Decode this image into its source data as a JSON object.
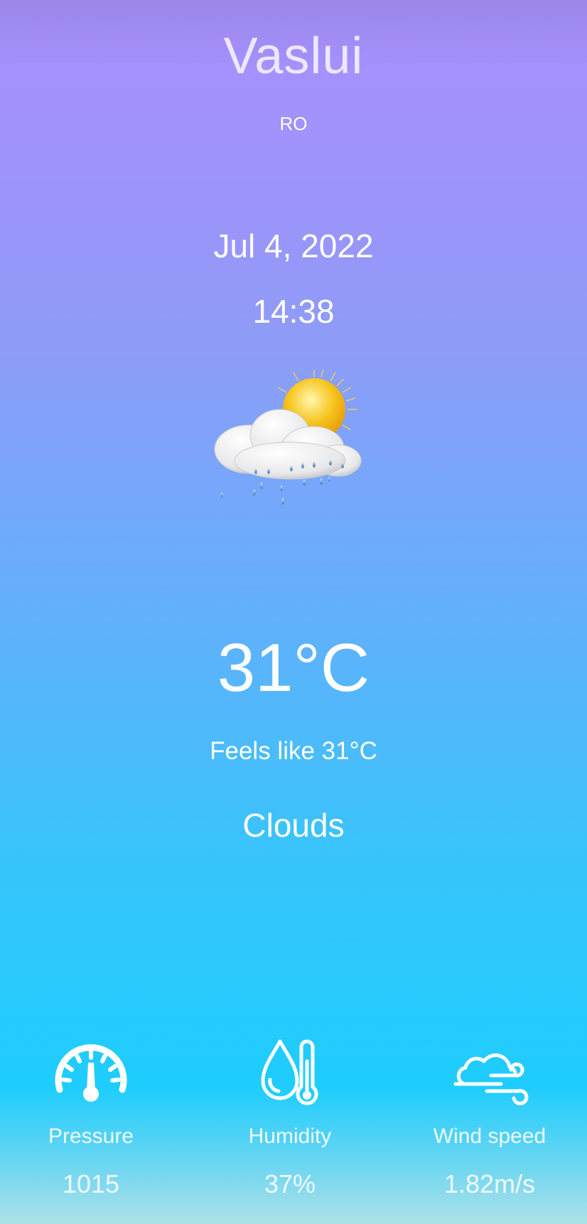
{
  "location": {
    "city": "Vaslui",
    "country": "RO"
  },
  "datetime": {
    "date": "Jul 4, 2022",
    "time": "14:38"
  },
  "current": {
    "icon": "sun-behind-cloud-with-rain-icon",
    "temperature": "31°C",
    "feels_like": "Feels like 31°C",
    "condition": "Clouds"
  },
  "stats": [
    {
      "icon": "pressure-gauge-icon",
      "label": "Pressure",
      "value": "1015"
    },
    {
      "icon": "humidity-drop-thermometer-icon",
      "label": "Humidity",
      "value": "37%"
    },
    {
      "icon": "wind-cloud-icon",
      "label": "Wind speed",
      "value": "1.82m/s"
    }
  ],
  "colors": {
    "gradient_top": "#a691fd",
    "gradient_middle": "#6faafb",
    "gradient_bottom": "#1ecdfd",
    "text": "#ffffff"
  }
}
